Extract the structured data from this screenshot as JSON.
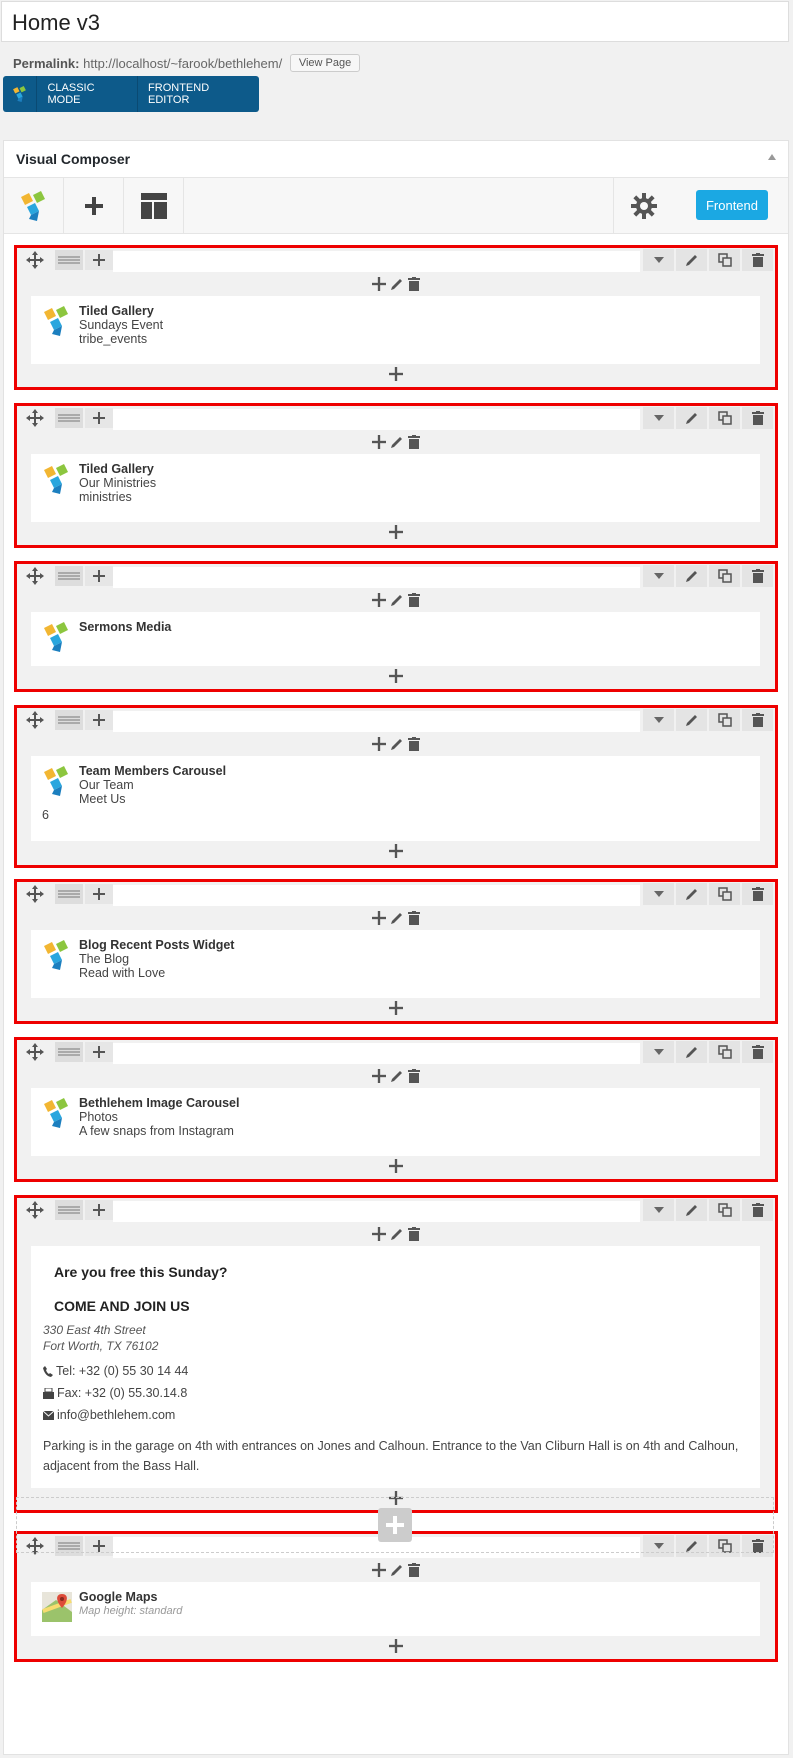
{
  "page": {
    "title": "Home v3"
  },
  "permalink": {
    "label": "Permalink:",
    "url": "http://localhost/~farook/bethlehem/",
    "view_page": "View Page"
  },
  "modes": {
    "classic": "CLASSIC MODE",
    "frontend_editor": "FRONTEND EDITOR"
  },
  "composer": {
    "title": "Visual Composer",
    "frontend_button": "Frontend"
  },
  "rows": [
    {
      "title": "Tiled Gallery",
      "lines": [
        "Sundays Event",
        "tribe_events"
      ]
    },
    {
      "title": "Tiled Gallery",
      "lines": [
        "Our Ministries",
        "ministries"
      ]
    },
    {
      "title": "Sermons Media",
      "lines": []
    },
    {
      "title": "Team Members Carousel",
      "lines": [
        "Our Team",
        "Meet Us"
      ],
      "extra": "6"
    },
    {
      "title": "Blog Recent Posts Widget",
      "lines": [
        "The Blog",
        "Read with Love"
      ]
    },
    {
      "title": "Bethlehem Image Carousel",
      "lines": [
        "Photos",
        "A few snaps from Instagram"
      ]
    },
    {
      "text_block": {
        "heading": "Are you free this Sunday?",
        "subheading": "COME AND JOIN US",
        "address1": "330 East 4th Street",
        "address2": "Fort Worth, TX 76102",
        "tel": "Tel: +32 (0) 55 30 14 44",
        "fax": "Fax: +32 (0) 55.30.14.8",
        "email": "info@bethlehem.com",
        "paragraph": "Parking is in the garage on 4th with entrances on Jones and Calhoun. Entrance to the Van Cliburn Hall is on 4th and Calhoun, adjacent from the Bass Hall."
      }
    },
    {
      "title": "Google Maps",
      "italic": "Map height: standard"
    }
  ],
  "colors": {
    "highlight": "#e00000",
    "accent": "#1ba8e3",
    "modebar": "#0d5a8a"
  }
}
